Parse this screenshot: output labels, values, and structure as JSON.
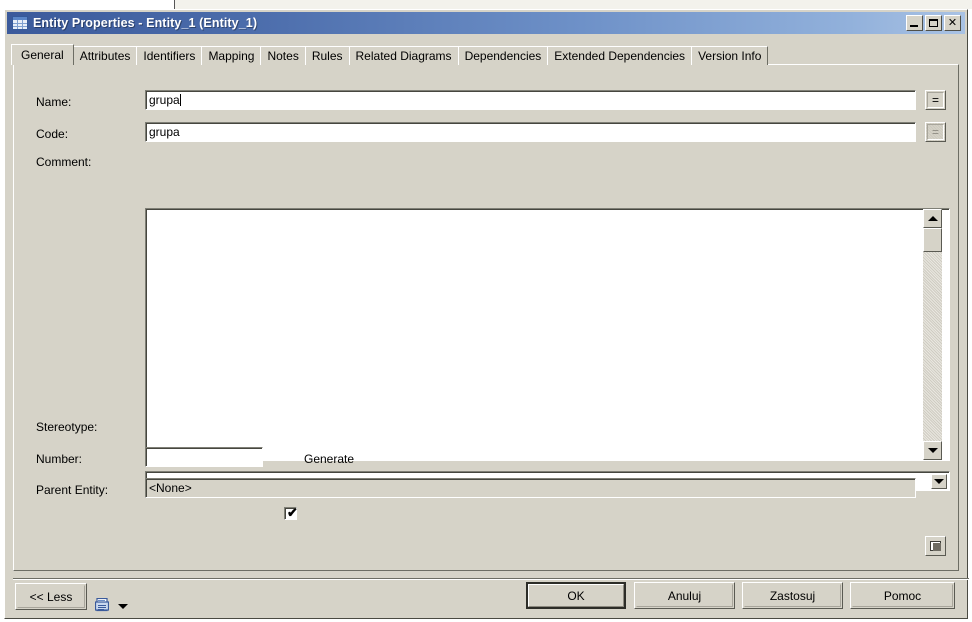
{
  "window": {
    "title": "Entity Properties - Entity_1 (Entity_1)",
    "icon": "entity-table-icon",
    "controls": {
      "minimize": "minimize-icon",
      "maximize": "maximize-icon",
      "close": "✕"
    }
  },
  "tabs": [
    {
      "label": "General",
      "active": true
    },
    {
      "label": "Attributes",
      "active": false
    },
    {
      "label": "Identifiers",
      "active": false
    },
    {
      "label": "Mapping",
      "active": false
    },
    {
      "label": "Notes",
      "active": false
    },
    {
      "label": "Rules",
      "active": false
    },
    {
      "label": "Related Diagrams",
      "active": false
    },
    {
      "label": "Dependencies",
      "active": false
    },
    {
      "label": "Extended Dependencies",
      "active": false
    },
    {
      "label": "Version Info",
      "active": false
    }
  ],
  "form": {
    "name": {
      "label": "Name:",
      "value": "grupa"
    },
    "name_equals_button": "=",
    "code": {
      "label": "Code:",
      "value": "grupa"
    },
    "code_equals_button": "=",
    "comment": {
      "label": "Comment:",
      "value": ""
    },
    "stereotype": {
      "label": "Stereotype:",
      "value": "",
      "options": []
    },
    "number": {
      "label": "Number:",
      "value": ""
    },
    "generate": {
      "label": "Generate",
      "checked": true,
      "mark": "✔"
    },
    "parent_entity": {
      "label": "Parent Entity:",
      "value": "<None>"
    }
  },
  "footer": {
    "less_button": "<< Less",
    "report_icon": "report-icon",
    "report_dropdown_icon": "chevron-down-icon",
    "ok_button": "OK",
    "cancel_button": "Anuluj",
    "apply_button": "Zastosuj",
    "help_button": "Pomoc"
  },
  "colors": {
    "titlebar_start": "#3b5a9b",
    "titlebar_end": "#a9c2e4",
    "dialog_face": "#d6d3c8",
    "field_bg": "#ffffff",
    "text": "#000000"
  }
}
